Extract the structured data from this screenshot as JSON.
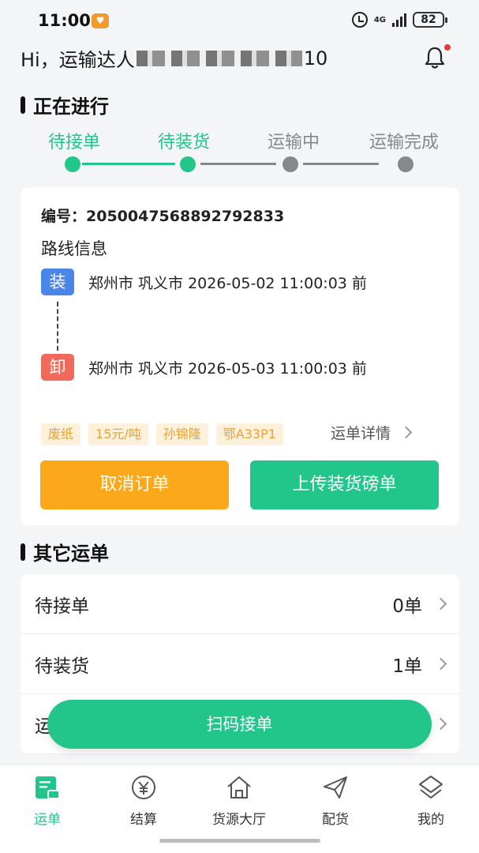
{
  "status": {
    "time": "11:00",
    "network": "4G",
    "battery": "82"
  },
  "greeting": {
    "prefix": "Hi，运输达人",
    "suffix": "10"
  },
  "sections": {
    "current": "正在进行",
    "other": "其它运单"
  },
  "steps": [
    {
      "label": "待接单",
      "active": true
    },
    {
      "label": "待装货",
      "active": true
    },
    {
      "label": "运输中",
      "active": false
    },
    {
      "label": "运输完成",
      "active": false
    }
  ],
  "order": {
    "number": "编号：2050047568892792833",
    "route_title": "路线信息",
    "load": {
      "tag": "装",
      "text": "郑州市 巩义市   2026-05-02 11:00:03 前"
    },
    "unload": {
      "tag": "卸",
      "text": "郑州市 巩义市   2026-05-03 11:00:03 前"
    },
    "chips": [
      "废纸",
      "15元/吨",
      "孙锦隆",
      "鄂A33P1"
    ],
    "detail_link": "运单详情",
    "cancel_label": "取消订单",
    "upload_label": "上传装货磅单"
  },
  "other_orders": [
    {
      "label": "待接单",
      "count": "0单"
    },
    {
      "label": "待装货",
      "count": "1单"
    },
    {
      "label": "运",
      "count": ""
    }
  ],
  "scan_label": "扫码接单",
  "tabs": [
    {
      "label": "运单",
      "icon": "waybill-icon",
      "active": true
    },
    {
      "label": "结算",
      "icon": "yuan-icon",
      "active": false
    },
    {
      "label": "货源大厅",
      "icon": "home-icon",
      "active": false
    },
    {
      "label": "配货",
      "icon": "send-icon",
      "active": false
    },
    {
      "label": "我的",
      "icon": "profile-icon",
      "active": false
    }
  ],
  "colors": {
    "green": "#22c58a",
    "orange": "#fba81b",
    "load_blue": "#4a86e8",
    "unload_red": "#ef6a5a",
    "inactive": "#888888"
  }
}
